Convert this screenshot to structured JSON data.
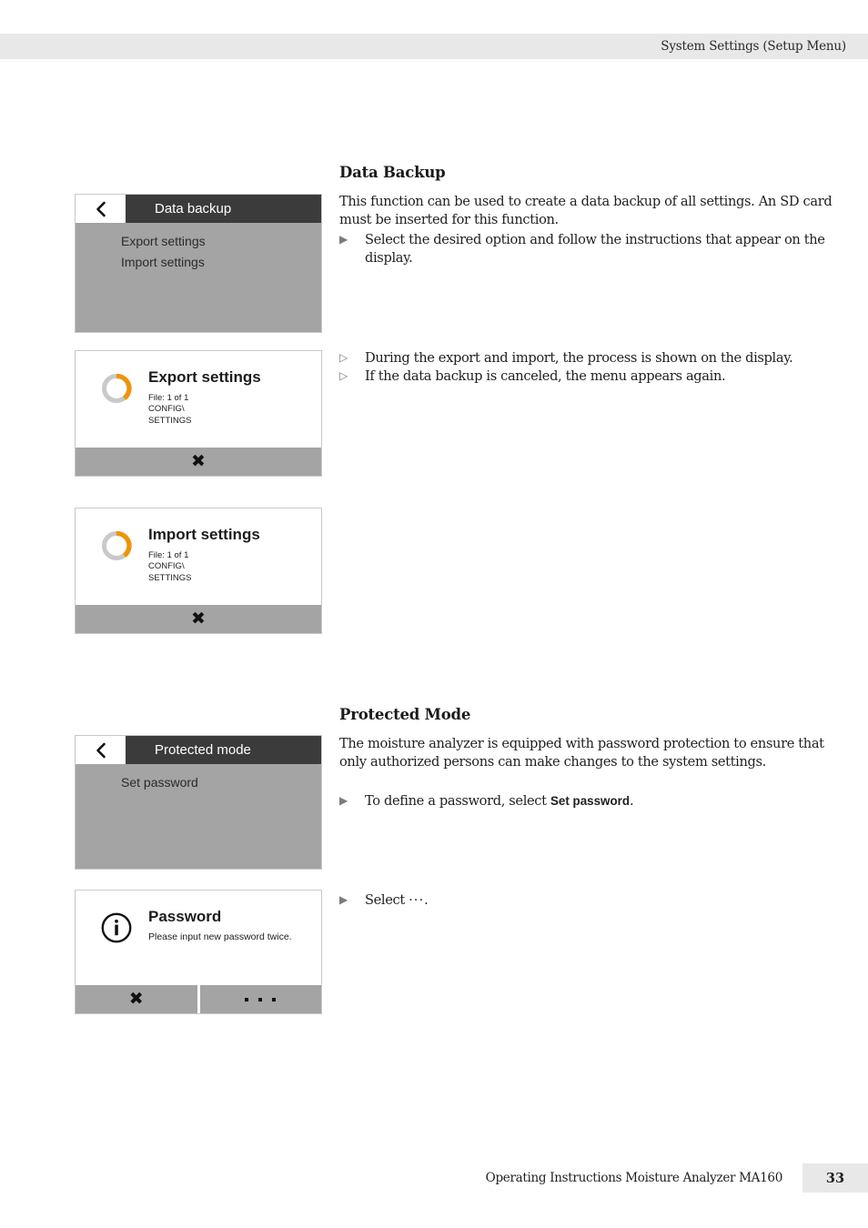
{
  "header": {
    "running_title": "System Settings (Setup Menu)"
  },
  "sections": [
    {
      "title": "Data Backup",
      "paragraph": "This function can be used to create a data backup of all settings. An SD card must be inserted for this function.",
      "bullets": [
        {
          "marker": "filled-triangle",
          "text": "Select the desired option and follow the instructions that appear on the display."
        }
      ],
      "notes": [
        {
          "marker": "hollow-triangle",
          "text": "During the export and import, the process is shown on the display."
        },
        {
          "marker": "hollow-triangle",
          "text": "If the data backup is canceled, the menu appears again."
        }
      ]
    },
    {
      "title": "Protected Mode",
      "paragraph": "The moisture analyzer is equipped with password protection to ensure that only authorized persons can make changes to the system settings.",
      "bullets": [
        {
          "marker": "filled-triangle",
          "text_before": "To define a password, select ",
          "bold": "Set password",
          "text_after": "."
        },
        {
          "marker": "filled-triangle",
          "text_before": "Select ",
          "dots": "···",
          "text_after": "."
        }
      ]
    }
  ],
  "mockups": {
    "data_backup_menu": {
      "back_icon": "chevron-left-icon",
      "title": "Data backup",
      "items": [
        "Export settings",
        "Import settings"
      ]
    },
    "export_settings_dialog": {
      "icon": "progress-spinner-icon",
      "title": "Export settings",
      "lines": [
        "File: 1 of 1",
        "CONFIG\\",
        "SETTINGS"
      ],
      "footer_buttons": [
        {
          "icon": "close-x-icon"
        }
      ]
    },
    "import_settings_dialog": {
      "icon": "progress-spinner-icon",
      "title": "Import settings",
      "lines": [
        "File: 1 of 1",
        "CONFIG\\",
        "SETTINGS"
      ],
      "footer_buttons": [
        {
          "icon": "close-x-icon"
        }
      ]
    },
    "protected_mode_menu": {
      "back_icon": "chevron-left-icon",
      "title": "Protected mode",
      "items": [
        "Set password"
      ]
    },
    "password_dialog": {
      "icon": "info-circle-icon",
      "title": "Password",
      "subtitle": "Please input new password twice.",
      "footer_buttons": [
        {
          "icon": "close-x-icon"
        },
        {
          "icon": "ellipsis-icon"
        }
      ]
    }
  },
  "footer": {
    "text": "Operating Instructions Moisture Analyzer MA160",
    "page_number": "33"
  },
  "colors": {
    "accent_orange": "#f39200",
    "header_gray": "#e8e8e8",
    "screen_gray": "#a4a4a4",
    "titlebar_dark": "#3b3b3b"
  }
}
